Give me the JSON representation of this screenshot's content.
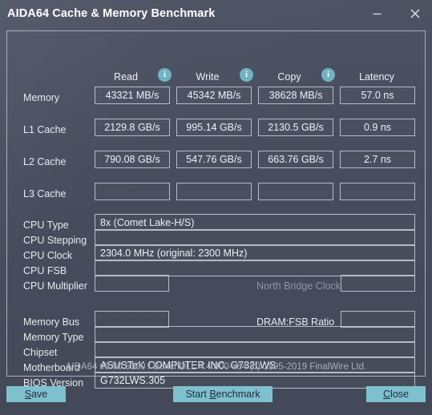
{
  "window": {
    "title": "AIDA64 Cache & Memory Benchmark",
    "minimize_label": "minimize",
    "close_label": "close"
  },
  "colors": {
    "accent": "#7fc0cf",
    "info_icon": "#6fb3c4",
    "window_bg": "#474d5c",
    "panel_border": "#a9b0bd",
    "text": "#e9ecf1",
    "dim_text": "#8d97a6"
  },
  "benchmark": {
    "columns": [
      {
        "label": "Read",
        "info_icon": "info-icon"
      },
      {
        "label": "Write",
        "info_icon": "info-icon"
      },
      {
        "label": "Copy",
        "info_icon": "info-icon"
      },
      {
        "label": "Latency",
        "info_icon": null
      }
    ],
    "rows": [
      {
        "label": "Memory",
        "read": "43321 MB/s",
        "write": "45342 MB/s",
        "copy": "38628 MB/s",
        "latency": "57.0 ns"
      },
      {
        "label": "L1 Cache",
        "read": "2129.8 GB/s",
        "write": "995.14 GB/s",
        "copy": "2130.5 GB/s",
        "latency": "0.9 ns"
      },
      {
        "label": "L2 Cache",
        "read": "790.08 GB/s",
        "write": "547.76 GB/s",
        "copy": "663.76 GB/s",
        "latency": "2.7 ns"
      },
      {
        "label": "L3 Cache",
        "read": "",
        "write": "",
        "copy": "",
        "latency": ""
      }
    ]
  },
  "cpu_info": {
    "cpu_type_label": "CPU Type",
    "cpu_type_value": "8x   (Comet Lake-H/S)",
    "cpu_stepping_label": "CPU Stepping",
    "cpu_stepping_value": "",
    "cpu_clock_label": "CPU Clock",
    "cpu_clock_value": "2304.0 MHz  (original: 2300 MHz)",
    "cpu_fsb_label": "CPU FSB",
    "cpu_fsb_value": "",
    "cpu_multiplier_label": "CPU Multiplier",
    "cpu_multiplier_value": "",
    "north_bridge_clock_label": "North Bridge Clock",
    "north_bridge_clock_value": ""
  },
  "system_info": {
    "memory_bus_label": "Memory Bus",
    "memory_bus_value": "",
    "dram_fsb_ratio_label": "DRAM:FSB Ratio",
    "dram_fsb_ratio_value": "",
    "memory_type_label": "Memory Type",
    "memory_type_value": "",
    "chipset_label": "Chipset",
    "chipset_value": "",
    "motherboard_label": "Motherboard",
    "motherboard_value": "ASUSTeK COMPUTER INC. G732LWS",
    "bios_version_label": "BIOS Version",
    "bios_version_value": "G732LWS.305"
  },
  "footer": {
    "version_text": "AIDA64 v6.00.5100 / BenchDLL 4.4.800-x64  (c) 1995-2019 FinalWire Ltd."
  },
  "buttons": {
    "save": {
      "prefix": "",
      "accel": "S",
      "suffix": "ave"
    },
    "start_benchmark": {
      "prefix": "Start ",
      "accel": "B",
      "suffix": "enchmark"
    },
    "close": {
      "prefix": "",
      "accel": "C",
      "suffix": "lose"
    }
  }
}
